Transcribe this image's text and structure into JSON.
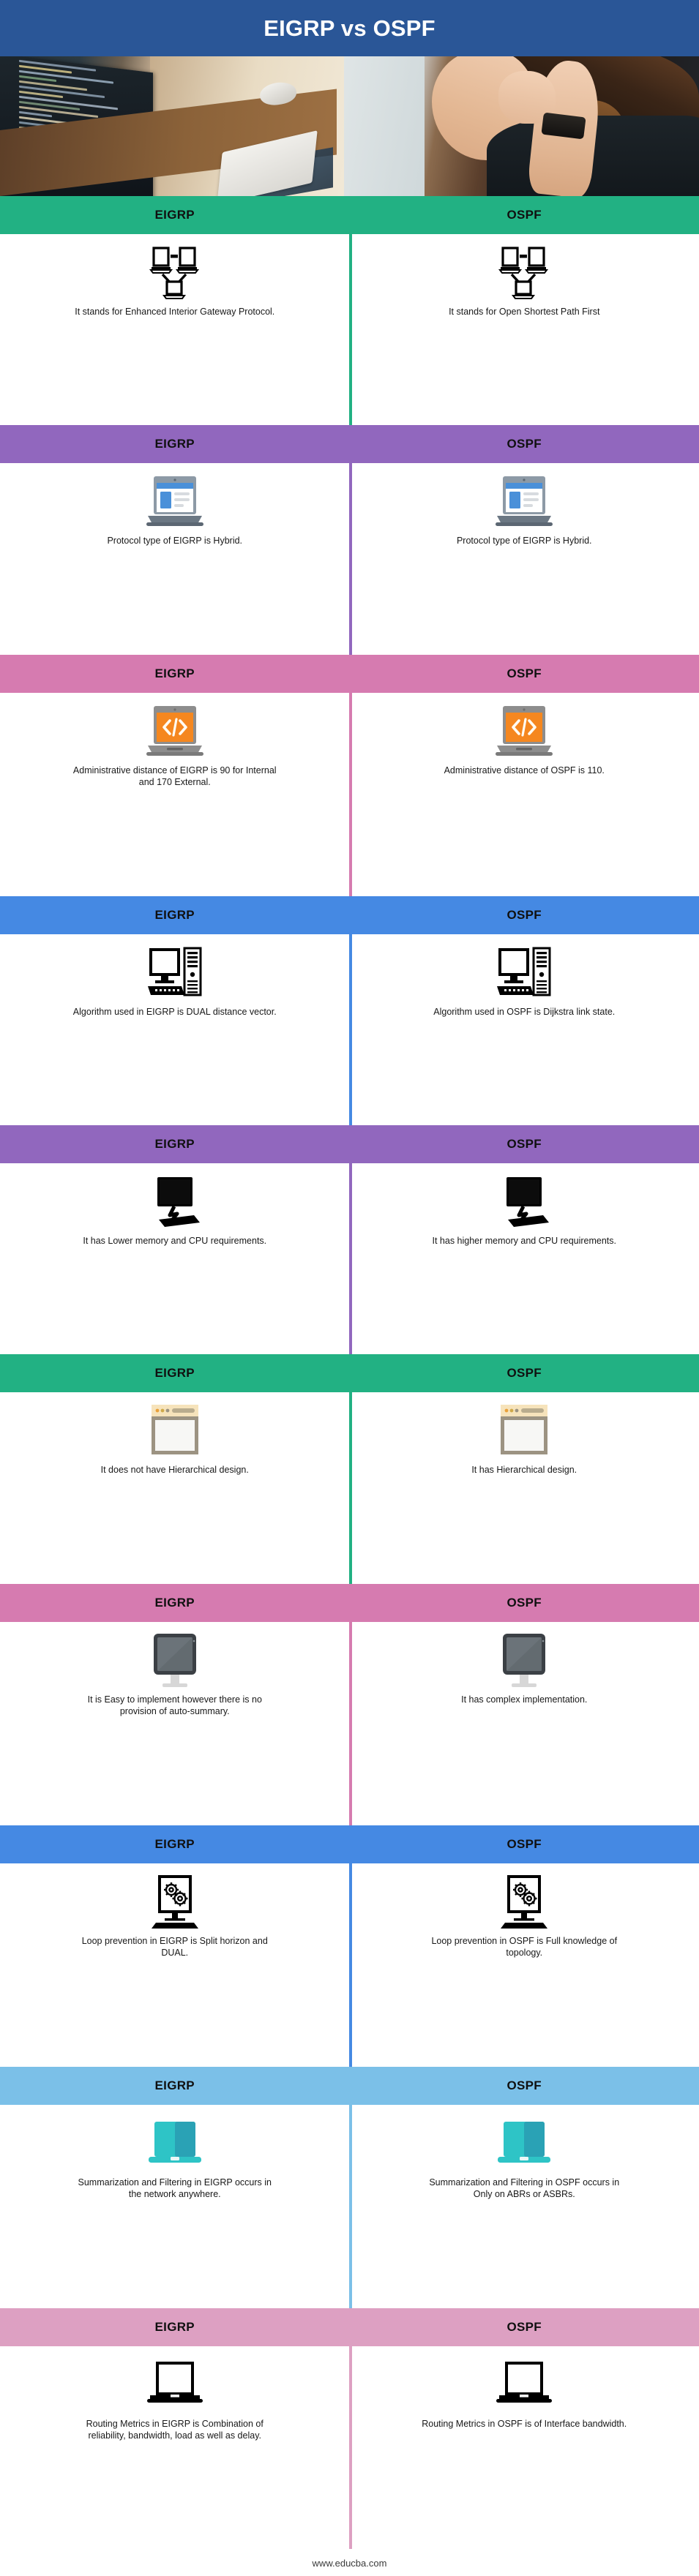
{
  "header": {
    "title": "EIGRP vs OSPF",
    "band_color": "#2A5697",
    "hero_alt": "woman at desk looking at code on monitor"
  },
  "labels": {
    "left": "EIGRP",
    "right": "OSPF"
  },
  "footer": {
    "site": "www.educba.com"
  },
  "colors": {
    "green": "#22B183",
    "purple": "#9167BE",
    "pink": "#D67BB0",
    "blue": "#4589E3",
    "light_blue": "#7BC0E8",
    "light_pink": "#DDA0C2",
    "header_blue": "#2A5697"
  },
  "sections": [
    {
      "band_color": "#22B183",
      "left_label": "EIGRP",
      "right_label": "OSPF",
      "icon": "network-topology-icon",
      "left_text": "It stands for Enhanced Interior Gateway Protocol.",
      "right_text": "It stands for Open Shortest Path First"
    },
    {
      "band_color": "#9167BE",
      "left_label": "EIGRP",
      "right_label": "OSPF",
      "icon": "laptop-webpage-icon",
      "left_text": "Protocol type of EIGRP is Hybrid.",
      "right_text": "Protocol type of EIGRP is Hybrid."
    },
    {
      "band_color": "#D67BB0",
      "left_label": "EIGRP",
      "right_label": "OSPF",
      "icon": "laptop-code-icon",
      "left_text": "Administrative distance of EIGRP is 90 for Internal and 170 External.",
      "right_text": "Administrative distance of OSPF is 110."
    },
    {
      "band_color": "#4589E3",
      "left_label": "EIGRP",
      "right_label": "OSPF",
      "icon": "desktop-tower-icon",
      "left_text": "Algorithm used in EIGRP is DUAL distance vector.",
      "right_text": "Algorithm used in OSPF is Dijkstra link state."
    },
    {
      "band_color": "#9167BE",
      "left_label": "EIGRP",
      "right_label": "OSPF",
      "icon": "monitor-keyboard-icon",
      "left_text": "It has Lower memory and CPU requirements.",
      "right_text": "It has higher memory and CPU requirements."
    },
    {
      "band_color": "#22B183",
      "left_label": "EIGRP",
      "right_label": "OSPF",
      "icon": "browser-window-icon",
      "left_text": "It does not have Hierarchical design.",
      "right_text": "It has Hierarchical design."
    },
    {
      "band_color": "#D67BB0",
      "left_label": "EIGRP",
      "right_label": "OSPF",
      "icon": "tablet-screen-icon",
      "left_text": "It is Easy to implement however there is no provision of auto-summary.",
      "right_text": "It has complex implementation."
    },
    {
      "band_color": "#4589E3",
      "left_label": "EIGRP",
      "right_label": "OSPF",
      "icon": "monitor-gears-icon",
      "left_text": "Loop prevention in EIGRP is Split horizon and DUAL.",
      "right_text": "Loop prevention in OSPF is Full knowledge of topology."
    },
    {
      "band_color": "#7BC0E8",
      "left_label": "EIGRP",
      "right_label": "OSPF",
      "icon": "teal-laptop-icon",
      "left_text": "Summarization and Filtering in EIGRP occurs in the network anywhere.",
      "right_text": "Summarization and Filtering in OSPF occurs in Only on ABRs or ASBRs."
    },
    {
      "band_color": "#DDA0C2",
      "left_label": "EIGRP",
      "right_label": "OSPF",
      "icon": "laptop-outline-icon",
      "left_text": "Routing Metrics in EIGRP is Combination of reliability, bandwidth, load as well as delay.",
      "right_text": "Routing Metrics in OSPF is of Interface bandwidth."
    }
  ]
}
